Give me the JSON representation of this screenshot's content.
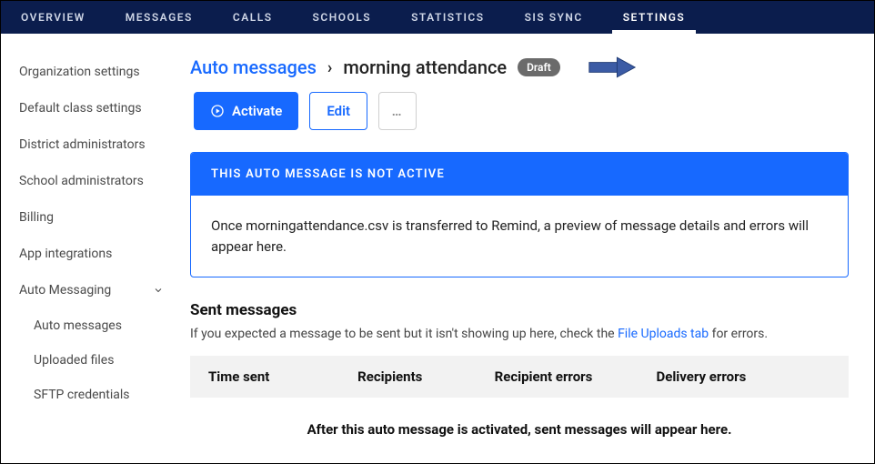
{
  "topnav": {
    "items": [
      {
        "label": "OVERVIEW"
      },
      {
        "label": "MESSAGES"
      },
      {
        "label": "CALLS"
      },
      {
        "label": "SCHOOLS"
      },
      {
        "label": "STATISTICS"
      },
      {
        "label": "SIS SYNC"
      },
      {
        "label": "SETTINGS"
      }
    ],
    "active_index": 6
  },
  "sidebar": {
    "items": [
      {
        "label": "Organization settings"
      },
      {
        "label": "Default class settings"
      },
      {
        "label": "District administrators"
      },
      {
        "label": "School administrators"
      },
      {
        "label": "Billing"
      },
      {
        "label": "App integrations"
      },
      {
        "label": "Auto Messaging",
        "expanded": true,
        "children": [
          {
            "label": "Auto messages"
          },
          {
            "label": "Uploaded files"
          },
          {
            "label": "SFTP credentials"
          }
        ]
      }
    ]
  },
  "breadcrumb": {
    "root": "Auto messages",
    "sep": "›",
    "current": "morning attendance",
    "status_badge": "Draft"
  },
  "actions": {
    "activate_label": "Activate",
    "edit_label": "Edit",
    "more_label": "…"
  },
  "banner": {
    "header": "THIS AUTO MESSAGE IS NOT ACTIVE",
    "body": "Once morningattendance.csv is transferred to Remind, a preview of message details and errors will appear here."
  },
  "sent_messages": {
    "title": "Sent messages",
    "hint_prefix": "If you expected a message to be sent but it isn't showing up here, check the ",
    "hint_link": "File Uploads tab",
    "hint_suffix": " for errors.",
    "columns": [
      "Time sent",
      "Recipients",
      "Recipient errors",
      "Delivery errors"
    ],
    "empty_text": "After this auto message is activated, sent messages will appear here."
  },
  "colors": {
    "brand_navy": "#0b1d4d",
    "brand_blue": "#1769ff",
    "badge_gray": "#6b6b6b"
  }
}
